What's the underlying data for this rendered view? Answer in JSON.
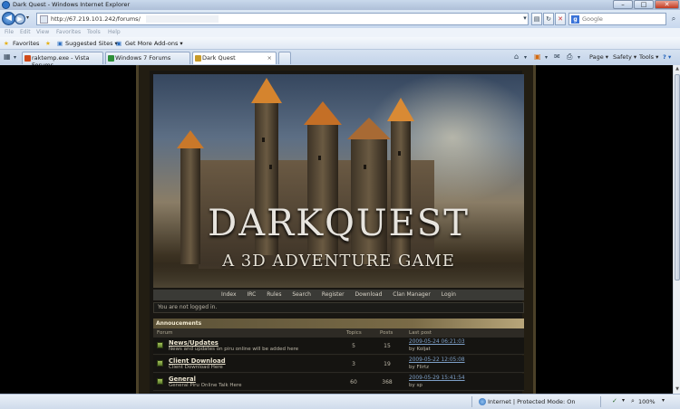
{
  "window": {
    "title": "Dark Quest - Windows Internet Explorer",
    "minimize": "–",
    "maximize": "□",
    "close": "✕"
  },
  "address": {
    "url": "http://67.219.101.242/forums/",
    "search_placeholder": "Google",
    "icons": [
      "back-icon",
      "forward-icon",
      "page-icon",
      "compat-view-icon",
      "refresh-icon",
      "stop-icon",
      "search-icon"
    ]
  },
  "menu": {
    "items": [
      "File",
      "Edit",
      "View",
      "Favorites",
      "Tools",
      "Help"
    ]
  },
  "favorites": {
    "favorites_label": "Favorites",
    "suggested_sites": "Suggested Sites ▾",
    "addons": "Get More Add-ons ▾"
  },
  "tabs": [
    {
      "label": "raktemp.exe - Vista Forums"
    },
    {
      "label": "Windows 7 Forums"
    },
    {
      "label": "Dark Quest",
      "close": "×"
    }
  ],
  "commands": {
    "page": "Page ▾",
    "safety": "Safety ▾",
    "tools": "Tools ▾",
    "help": "? ▾"
  },
  "banner": {
    "title": "DARKQUEST",
    "subtitle": "A 3D ADVENTURE GAME"
  },
  "site_nav": [
    "Index",
    "IRC",
    "Rules",
    "Search",
    "Register",
    "Download",
    "Clan Manager",
    "Login"
  ],
  "login_status": "You are not logged in.",
  "forum": {
    "category": "Annoucements",
    "headers": {
      "forum": "Forum",
      "topics": "Topics",
      "posts": "Posts",
      "last_post": "Last post"
    },
    "rows": [
      {
        "name": "News/Updates",
        "desc": "News and updates on piru online will be added here",
        "topics": "5",
        "posts": "15",
        "last_date": "2009-05-24 06:21:03",
        "last_by": "by Koljat"
      },
      {
        "name": "Client Download",
        "desc": "Client Download Here",
        "topics": "3",
        "posts": "19",
        "last_date": "2009-05-22 12:05:08",
        "last_by": "by Flirtz"
      },
      {
        "name": "General",
        "desc": "General Piru Online Talk Here",
        "topics": "60",
        "posts": "368",
        "last_date": "2009-05-29 15:41:54",
        "last_by": "by sp"
      }
    ]
  },
  "status": {
    "zone": "Internet | Protected Mode: On",
    "zoom": "100%"
  }
}
